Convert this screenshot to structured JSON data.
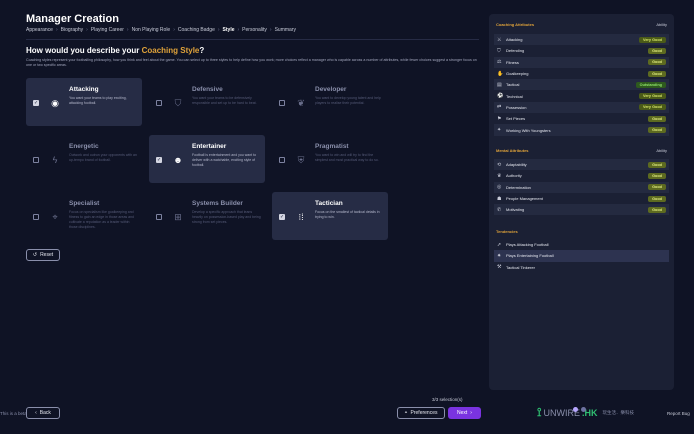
{
  "header": {
    "title": "Manager Creation",
    "breadcrumb": [
      "Appearance",
      "Biography",
      "Playing Career",
      "Non Playing Role",
      "Coaching Badge",
      "Style",
      "Personality",
      "Summary"
    ],
    "question_prefix": "How would you describe your",
    "question_highlight": "Coaching Style",
    "question_suffix": "?",
    "intro": "Coaching styles represent your footballing philosophy, how you think and feel about the game. You can select up to three styles to help define how you work; more choices reflect a manager who is capable across a number of attributes, while fewer choices suggest a stronger focus on one or two specific areas."
  },
  "styles": [
    {
      "name": "Attacking",
      "desc": "You want your teams to play exciting, attacking football.",
      "icon": "target-icon",
      "selected": true,
      "check": "✓"
    },
    {
      "name": "Defensive",
      "desc": "You want your teams to be defensively responsible and set up to be hard to beat.",
      "icon": "shield-icon",
      "selected": false,
      "check": ""
    },
    {
      "name": "Developer",
      "desc": "You want to develop young talent and help players to realise their potential.",
      "icon": "seedling-icon",
      "selected": false,
      "check": ""
    },
    {
      "name": "Energetic",
      "desc": "Outwork and outrun your opponents with an up-tempo brand of football.",
      "icon": "lightning-icon",
      "selected": false,
      "check": ""
    },
    {
      "name": "Entertainer",
      "desc": "Football is entertainment and you want to deliver with a watchable, exciting style of football.",
      "icon": "smile-icon",
      "selected": true,
      "check": "✓"
    },
    {
      "name": "Pragmatist",
      "desc": "You want to win and will try to find the simplest and most practical way to do so.",
      "icon": "shield-check-icon",
      "selected": false,
      "check": ""
    },
    {
      "name": "Specialist",
      "desc": "Focus on specialism like goalkeeping and fitness to gain an edge in those areas and cultivate a reputation as a leader within those disciplines.",
      "icon": "crosshair-icon",
      "selected": false,
      "check": ""
    },
    {
      "name": "Systems Builder",
      "desc": "Develop a specific approach that leans heavily on possession-based play and being strong from set pieces.",
      "icon": "grid-icon",
      "selected": false,
      "check": ""
    },
    {
      "name": "Tactician",
      "desc": "Focus on the smallest of tactical details in trying to win.",
      "icon": "tactics-icon",
      "selected": true,
      "check": "✓"
    }
  ],
  "buttons": {
    "reset": "Reset",
    "back": "Back",
    "preferences": "Preferences",
    "next": "Next",
    "selection_count": "3/3 selection(s)"
  },
  "footnote": "This is a beta",
  "report_bug": "Report Bug",
  "watermark": {
    "logo": "UNWIRE",
    "hk": ".HK",
    "sub": "玩生活．樂科技"
  },
  "panel": {
    "ability_header": "Ability",
    "coaching_title": "Coaching Attributes",
    "coaching": [
      {
        "label": "Attacking",
        "value": "Very Good",
        "icon": "sword-icon",
        "cls": "vg"
      },
      {
        "label": "Defending",
        "value": "Good",
        "icon": "shield-icon",
        "cls": "g"
      },
      {
        "label": "Fitness",
        "value": "Good",
        "icon": "dumbbell-icon",
        "cls": "g"
      },
      {
        "label": "Goalkeeping",
        "value": "Good",
        "icon": "glove-icon",
        "cls": "g"
      },
      {
        "label": "Tactical",
        "value": "Outstanding",
        "icon": "clipboard-icon",
        "cls": "out"
      },
      {
        "label": "Technical",
        "value": "Very Good",
        "icon": "ball-icon",
        "cls": "vg"
      },
      {
        "label": "Possession",
        "value": "Very Good",
        "icon": "possession-icon",
        "cls": "vg"
      },
      {
        "label": "Set Pieces",
        "value": "Good",
        "icon": "flag-icon",
        "cls": "g"
      },
      {
        "label": "Working With Youngsters",
        "value": "Good",
        "icon": "youth-icon",
        "cls": "g"
      }
    ],
    "mental_title": "Mental Attributes",
    "mental": [
      {
        "label": "Adaptability",
        "value": "Good",
        "icon": "adapt-icon",
        "cls": "g"
      },
      {
        "label": "Authority",
        "value": "Good",
        "icon": "authority-icon",
        "cls": "g"
      },
      {
        "label": "Determination",
        "value": "Good",
        "icon": "determination-icon",
        "cls": "g"
      },
      {
        "label": "People Management",
        "value": "Good",
        "icon": "people-icon",
        "cls": "g"
      },
      {
        "label": "Motivating",
        "value": "Good",
        "icon": "megaphone-icon",
        "cls": "g"
      }
    ],
    "tendencies_title": "Tendencies",
    "tendencies": [
      {
        "label": "Plays Attacking Football",
        "icon": "arrow-icon"
      },
      {
        "label": "Plays Entertaining Football",
        "icon": "star-icon"
      },
      {
        "label": "Tactical Tinkerer",
        "icon": "wrench-icon"
      }
    ]
  },
  "colors": {
    "accent": "#e0a33a",
    "next": "#7a33e0",
    "background": "#0f1325",
    "panel": "#1b2034"
  }
}
